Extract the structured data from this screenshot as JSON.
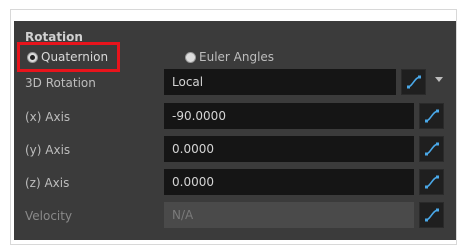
{
  "panel": {
    "title": "Rotation",
    "radio_quaternion": "Quaternion",
    "radio_euler": "Euler Angles",
    "selected_mode": "Quaternion",
    "rows": [
      {
        "label": "3D Rotation",
        "value": "Local",
        "kind": "combo"
      },
      {
        "label": "(x) Axis",
        "value": "-90.0000",
        "kind": "field"
      },
      {
        "label": "(y) Axis",
        "value": "0.0000",
        "kind": "field"
      },
      {
        "label": "(z) Axis",
        "value": "0.0000",
        "kind": "field"
      },
      {
        "label": "Velocity",
        "value": "N/A",
        "kind": "disabled"
      }
    ]
  },
  "colors": {
    "panel_bg": "#3b3b3b",
    "field_bg": "#151515",
    "highlight": "#e8141c",
    "function_icon": "#4aa8e8"
  },
  "icons": {
    "function_button": "function-curve-icon",
    "dropdown": "chevron-down-icon"
  }
}
